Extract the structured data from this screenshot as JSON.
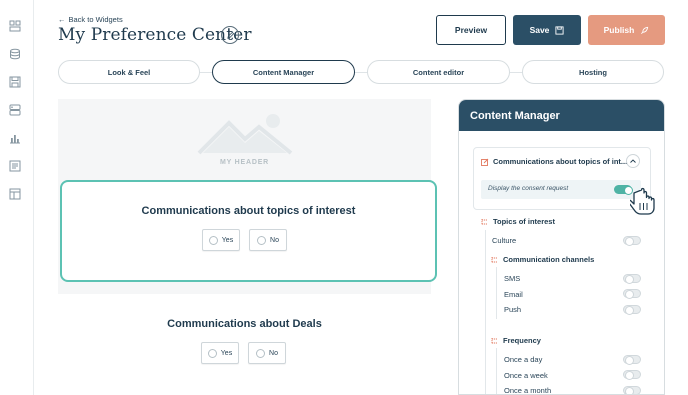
{
  "nav": {
    "back_label": "Back to Widgets",
    "rail_icons": [
      "layout-icon",
      "database-icon",
      "save-icon",
      "widgets-icon",
      "chart-icon",
      "form-icon",
      "template-icon"
    ]
  },
  "header": {
    "title": "My Preference Center",
    "preview_label": "Preview",
    "save_label": "Save",
    "publish_label": "Publish"
  },
  "steps": [
    {
      "label": "Look & Feel",
      "active": false
    },
    {
      "label": "Content Manager",
      "active": true
    },
    {
      "label": "Content editor",
      "active": false
    },
    {
      "label": "Hosting",
      "active": false
    }
  ],
  "canvas": {
    "header_placeholder": "MY HEADER",
    "cards": [
      {
        "title": "Communications about topics of interest",
        "yes": "Yes",
        "no": "No",
        "selected": true
      },
      {
        "title": "Communications about Deals",
        "yes": "Yes",
        "no": "No",
        "selected": false
      }
    ]
  },
  "panel": {
    "title": "Content Manager",
    "section_title": "Communications about topics of int...",
    "consent_label": "Display the consent request",
    "consent_on": true,
    "topics_title": "Topics of interest",
    "topics": [
      {
        "label": "Culture",
        "on": false
      }
    ],
    "channels_title": "Communication channels",
    "channels": [
      {
        "label": "SMS",
        "on": false
      },
      {
        "label": "Email",
        "on": false
      },
      {
        "label": "Push",
        "on": false
      }
    ],
    "frequency_title": "Frequency",
    "frequency": [
      {
        "label": "Once a day",
        "on": false
      },
      {
        "label": "Once a week",
        "on": false
      },
      {
        "label": "Once a month",
        "on": false
      }
    ]
  },
  "colors": {
    "primary": "#2b4f66",
    "accent_teal": "#4fb3a5",
    "publish": "#e59a80",
    "selection_border": "#5cc2b3"
  }
}
